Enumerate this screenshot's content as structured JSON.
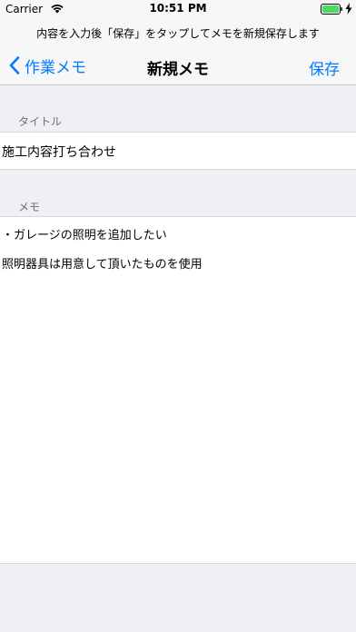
{
  "status_bar": {
    "carrier": "Carrier",
    "time": "10:51 PM",
    "icons": [
      "wifi-icon",
      "battery-icon",
      "charging-bolt-icon"
    ]
  },
  "nav": {
    "prompt": "内容を入力後「保存」をタップしてメモを新規保存します",
    "back_label": "作業メモ",
    "title": "新規メモ",
    "save_label": "保存"
  },
  "form": {
    "title_header": "タイトル",
    "title_value": "施工内容打ち合わせ",
    "memo_header": "メモ",
    "memo_lines": [
      "・ガレージの照明を追加したい",
      "照明器具は用意して頂いたものを使用"
    ]
  },
  "colors": {
    "accent": "#007aff",
    "background": "#efeff4",
    "bar": "#f7f7f7"
  }
}
